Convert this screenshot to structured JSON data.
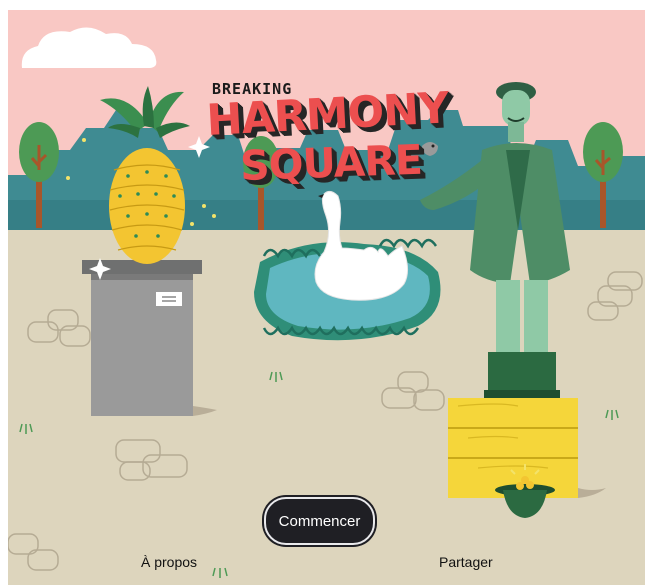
{
  "game": {
    "title_small": "BREAKING",
    "title_line1": "HARMONY",
    "title_line2": "SQUARE"
  },
  "menu": {
    "start_label": "Commencer",
    "about_label": "À propos",
    "share_label": "Partager"
  },
  "palette": {
    "sky": "#f9c8c4",
    "ground": "#ddd5bd",
    "skyline": "#3f8b92",
    "title_red": "#ec4f4f",
    "button_dark": "#1f1f24",
    "pineapple": "#f3c531",
    "crate": "#f5d63a",
    "pond": "#5fb7c0",
    "statue": "#8fc9a6"
  },
  "icons": [
    "sparkle-icon",
    "bird-icon"
  ]
}
